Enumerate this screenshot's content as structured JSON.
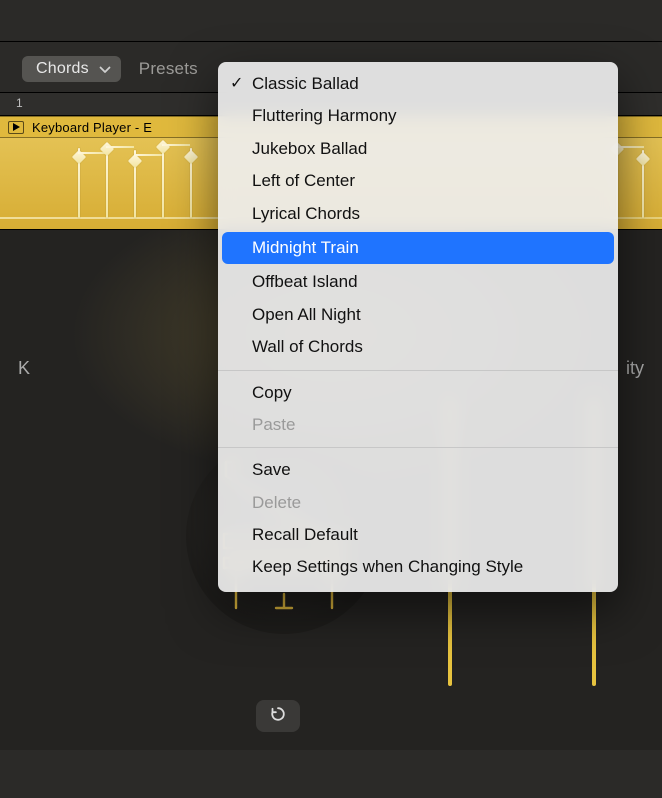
{
  "toolbar": {
    "chords_label": "Chords",
    "presets_label": "Presets"
  },
  "timeline": {
    "marker1": "1"
  },
  "track": {
    "header_label": "Keyboard Player - E"
  },
  "panel": {
    "left_label": "K",
    "right_label": "ity"
  },
  "menu": {
    "presets": [
      {
        "label": "Classic Ballad",
        "checked": true,
        "highlight": false
      },
      {
        "label": "Fluttering Harmony",
        "checked": false,
        "highlight": false
      },
      {
        "label": "Jukebox Ballad",
        "checked": false,
        "highlight": false
      },
      {
        "label": "Left of Center",
        "checked": false,
        "highlight": false
      },
      {
        "label": "Lyrical Chords",
        "checked": false,
        "highlight": false
      },
      {
        "label": "Midnight Train",
        "checked": false,
        "highlight": true
      },
      {
        "label": "Offbeat Island",
        "checked": false,
        "highlight": false
      },
      {
        "label": "Open All Night",
        "checked": false,
        "highlight": false
      },
      {
        "label": "Wall of Chords",
        "checked": false,
        "highlight": false
      }
    ],
    "actions1": [
      {
        "label": "Copy",
        "disabled": false
      },
      {
        "label": "Paste",
        "disabled": true
      }
    ],
    "actions2": [
      {
        "label": "Save",
        "disabled": false
      },
      {
        "label": "Delete",
        "disabled": true
      },
      {
        "label": "Recall Default",
        "disabled": false
      },
      {
        "label": "Keep Settings when Changing Style",
        "disabled": false
      }
    ]
  }
}
